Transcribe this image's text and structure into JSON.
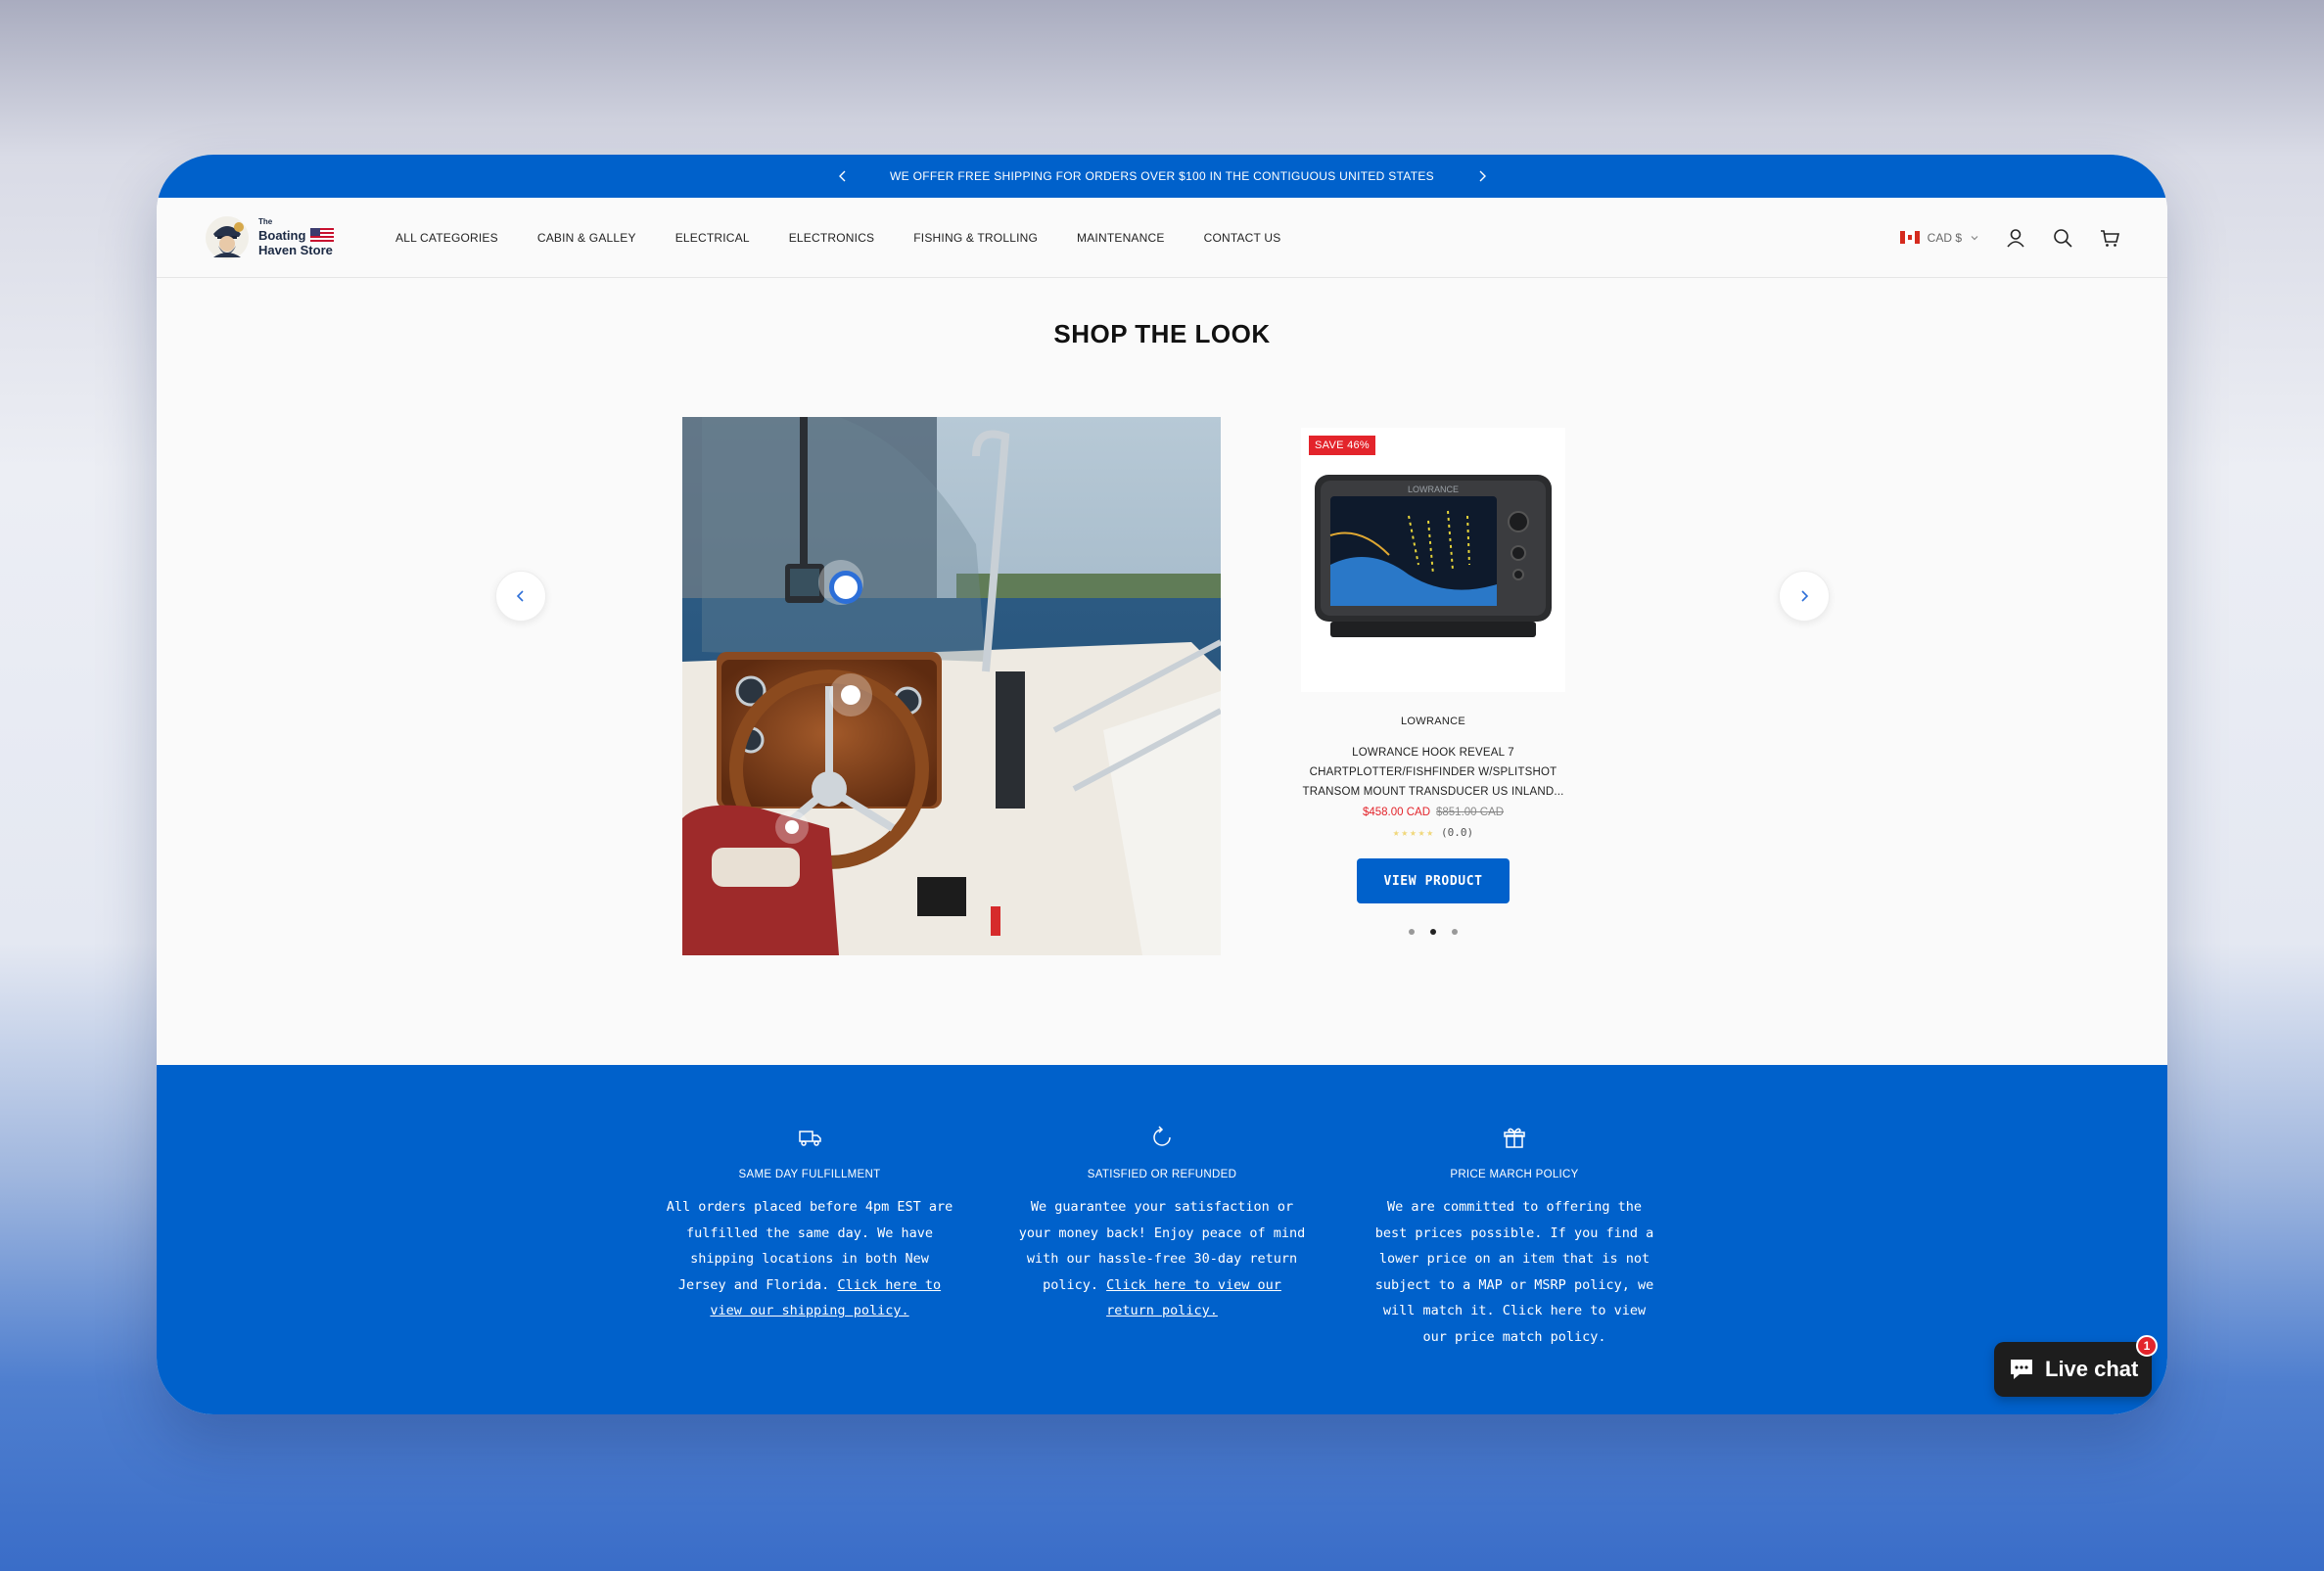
{
  "announcement": {
    "text": "WE OFFER FREE SHIPPING FOR ORDERS OVER $100 IN THE CONTIGUOUS UNITED STATES"
  },
  "logo": {
    "small": "The",
    "line1": "Boating",
    "line2": "Haven Store"
  },
  "nav": {
    "items": [
      "ALL CATEGORIES",
      "CABIN & GALLEY",
      "ELECTRICAL",
      "ELECTRONICS",
      "FISHING & TROLLING",
      "MAINTENANCE",
      "CONTACT US"
    ]
  },
  "header": {
    "currency": "CAD $"
  },
  "shop_the_look": {
    "title": "SHOP THE LOOK",
    "product": {
      "badge": "SAVE 46%",
      "brand": "LOWRANCE",
      "title": "LOWRANCE HOOK REVEAL 7 CHARTPLOTTER/FISHFINDER W/SPLITSHOT TRANSOM MOUNT TRANSDUCER US INLAND...",
      "sale_price": "$458.00 CAD",
      "original_price": "$851.00 CAD",
      "stars": "★★★★★",
      "rating": "(0.0)",
      "button": "VIEW PRODUCT",
      "screen_brand": "LOWRANCE"
    },
    "active_dot": 2
  },
  "features": [
    {
      "icon": "truck-icon",
      "title": "SAME DAY FULFILLMENT",
      "text": "All orders placed before 4pm EST are fulfilled the same day. We have shipping locations in both New Jersey and Florida. ",
      "link": "Click here to view our shipping policy."
    },
    {
      "icon": "refresh-icon",
      "title": "SATISFIED OR REFUNDED",
      "text": "We guarantee your satisfaction or your money back! Enjoy peace of mind with our hassle-free 30-day return policy. ",
      "link": "Click here to view our return policy."
    },
    {
      "icon": "gift-icon",
      "title": "PRICE MARCH POLICY",
      "text": "We are committed to offering the best prices possible. If you find a lower price on an item that is not subject to a MAP or MSRP policy, we will match it. Click here to view our price match policy.",
      "link": ""
    }
  ],
  "live_chat": {
    "label": "Live chat",
    "badge": "1"
  },
  "colors": {
    "brand_blue": "#0061cb",
    "sale_red": "#e3242b"
  }
}
